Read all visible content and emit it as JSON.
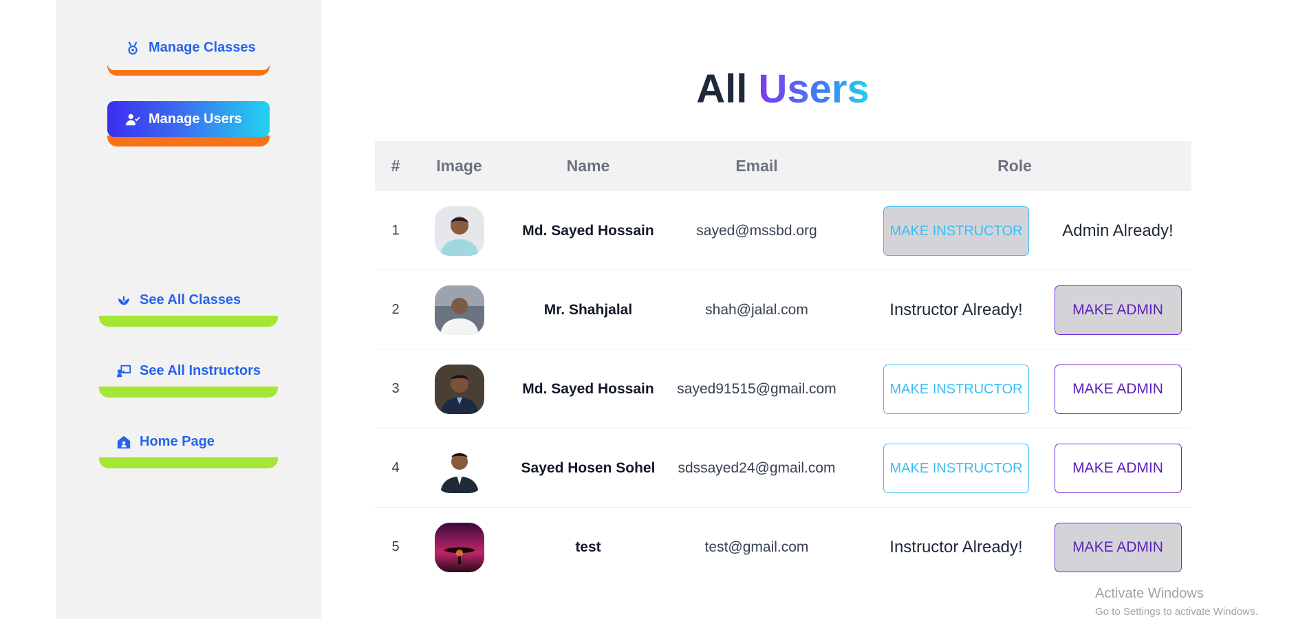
{
  "sidebar": {
    "manage_classes": "Manage Classes",
    "manage_users": "Manage Users",
    "see_all_classes": "See All Classes",
    "see_all_instructors": "See All Instructors",
    "home_page": "Home Page"
  },
  "title": {
    "part1": "All ",
    "part2": "Users"
  },
  "table": {
    "headers": [
      "#",
      "Image",
      "Name",
      "Email",
      "Role"
    ],
    "rows": [
      {
        "num": "1",
        "name": "Md. Sayed Hossain",
        "email": "sayed@mssbd.org",
        "instructor_label": "MAKE INSTRUCTOR",
        "admin_label": "Admin Already!"
      },
      {
        "num": "2",
        "name": "Mr. Shahjalal",
        "email": "shah@jalal.com",
        "instructor_label": "Instructor Already!",
        "admin_label": "MAKE ADMIN"
      },
      {
        "num": "3",
        "name": "Md. Sayed Hossain",
        "email": "sayed91515@gmail.com",
        "instructor_label": "MAKE INSTRUCTOR",
        "admin_label": "MAKE ADMIN"
      },
      {
        "num": "4",
        "name": "Sayed Hosen Sohel",
        "email": "sdssayed24@gmail.com",
        "instructor_label": "MAKE INSTRUCTOR",
        "admin_label": "MAKE ADMIN"
      },
      {
        "num": "5",
        "name": "test",
        "email": "test@gmail.com",
        "instructor_label": "Instructor Already!",
        "admin_label": "MAKE ADMIN"
      }
    ]
  },
  "watermark": {
    "line1": "Activate Windows",
    "line2": "Go to Settings to activate Windows."
  },
  "colors": {
    "link": "#2563eb",
    "orange": "#f97316",
    "green": "#a3e635",
    "instructor": "#38bdf8",
    "admin": "#5b21b6"
  }
}
